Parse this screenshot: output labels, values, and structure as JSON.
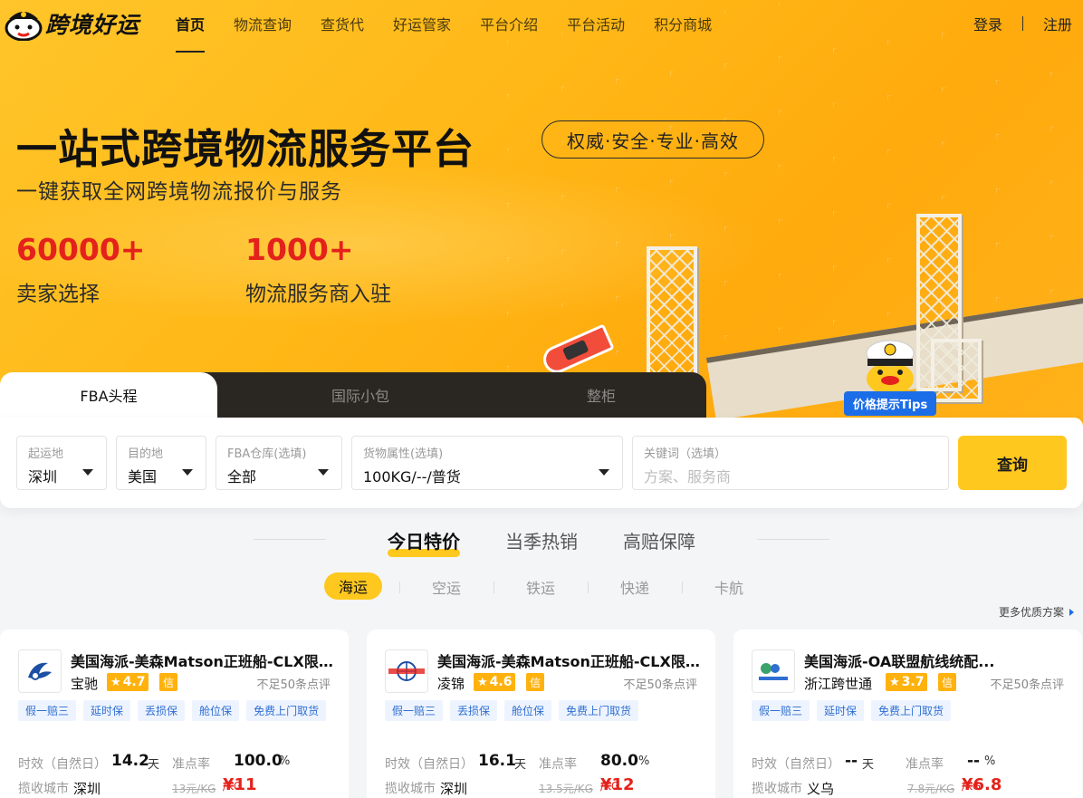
{
  "brand": {
    "name": "跨境好运"
  },
  "nav": {
    "items": [
      "首页",
      "物流查询",
      "查货代",
      "好运管家",
      "平台介绍",
      "平台活动",
      "积分商城"
    ],
    "login": "登录",
    "register": "注册"
  },
  "hero": {
    "title": "一站式跨境物流服务平台",
    "tag": "权威·安全·专业·高效",
    "subtitle": "一键获取全网跨境物流报价与服务",
    "stats": [
      {
        "value": "60000+",
        "label": "卖家选择"
      },
      {
        "value": "1000+",
        "label": "物流服务商入驻"
      }
    ],
    "tips": "价格提示Tips"
  },
  "search": {
    "tabs": [
      "FBA头程",
      "国际小包",
      "整柜"
    ],
    "fields": [
      {
        "label": "起运地",
        "value": "深圳"
      },
      {
        "label": "目的地",
        "value": "美国"
      },
      {
        "label": "FBA仓库(选填)",
        "value": "全部"
      },
      {
        "label": "货物属性(选填)",
        "value": "100KG/--/普货"
      },
      {
        "label": "关键词（选填）",
        "placeholder": "方案、服务商"
      }
    ],
    "button": "查询"
  },
  "sections": {
    "tabs": [
      "今日特价",
      "当季热销",
      "高赔保障"
    ],
    "modes": [
      "海运",
      "空运",
      "铁运",
      "快递",
      "卡航"
    ],
    "more": "更多优质方案"
  },
  "colors": {
    "accent": "#ffc81f",
    "price": "#e4221b",
    "tag": "#2f6fd1"
  },
  "cards": [
    {
      "title": "美国海派-美森Matson正班船-CLX限...",
      "vendor": "宝驰",
      "rating": "4.7",
      "badge": "信",
      "reviews": "不足50条点评",
      "tags": [
        "假一赔三",
        "延时保",
        "丢损保",
        "舱位保",
        "免费上门取货"
      ],
      "time_label": "时效（自然日）",
      "time_value": "14.2",
      "time_unit": "天",
      "rate_label": "准点率",
      "rate_value": "100.0",
      "rate_unit": "%",
      "city_label": "揽收城市",
      "city": "深圳",
      "old_price": "13元/KG",
      "price": "¥11",
      "price_unit": "/KG"
    },
    {
      "title": "美国海派-美森Matson正班船-CLX限...",
      "vendor": "凌锦",
      "rating": "4.6",
      "badge": "信",
      "reviews": "不足50条点评",
      "tags": [
        "假一赔三",
        "丢损保",
        "舱位保",
        "免费上门取货"
      ],
      "time_label": "时效（自然日）",
      "time_value": "16.1",
      "time_unit": "天",
      "rate_label": "准点率",
      "rate_value": "80.0",
      "rate_unit": "%",
      "city_label": "揽收城市",
      "city": "深圳",
      "old_price": "13.5元/KG",
      "price": "¥12",
      "price_unit": "/KG"
    },
    {
      "title": "美国海派-OA联盟航线统配...",
      "vendor": "浙江跨世通",
      "rating": "3.7",
      "badge": "信",
      "reviews": "不足50条点评",
      "tags": [
        "假一赔三",
        "延时保",
        "免费上门取货"
      ],
      "time_label": "时效（自然日）",
      "time_value": "--",
      "time_unit": "天",
      "rate_label": "准点率",
      "rate_value": "--",
      "rate_unit": "%",
      "city_label": "揽收城市",
      "city": "义乌",
      "old_price": "7.8元/KG",
      "price": "¥6.8",
      "price_unit": "/KG"
    }
  ]
}
